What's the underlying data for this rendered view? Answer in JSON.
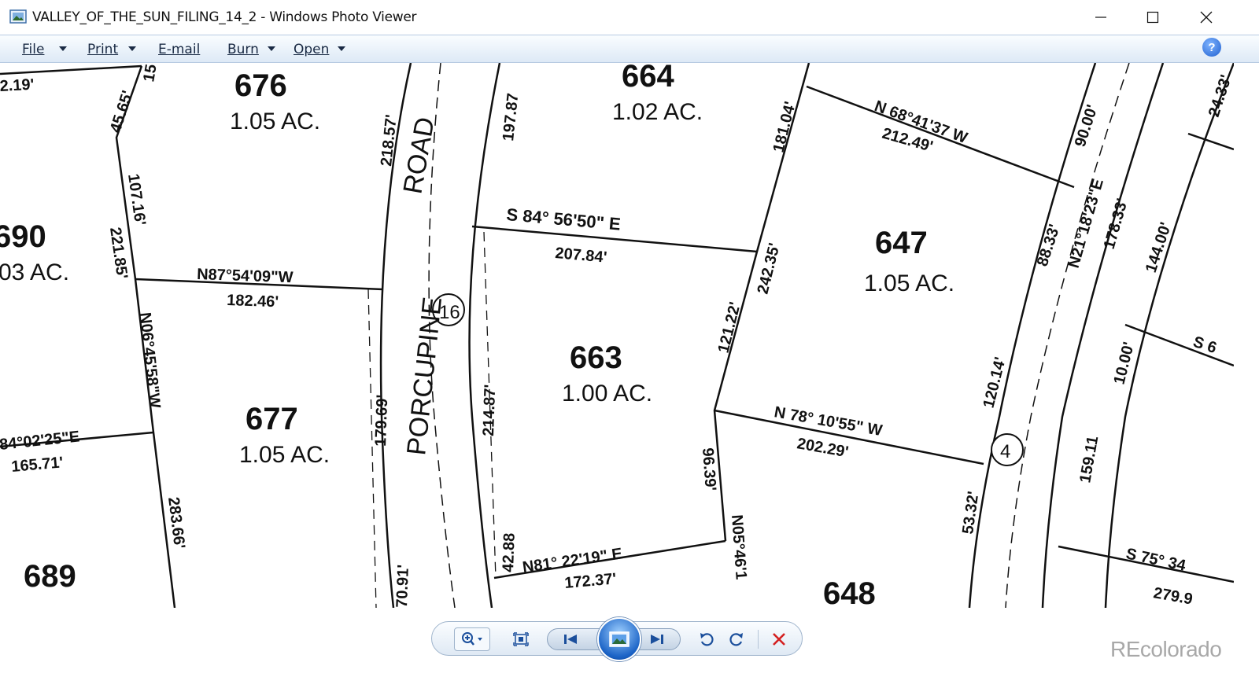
{
  "window": {
    "title": "VALLEY_OF_THE_SUN_FILING_14_2 - Windows Photo Viewer"
  },
  "menu": {
    "file": "File",
    "print": "Print",
    "email": "E-mail",
    "burn": "Burn",
    "open": "Open",
    "help": "?"
  },
  "map": {
    "lots": [
      {
        "number": "676",
        "acres": "1.05 AC."
      },
      {
        "number": "664",
        "acres": "1.02 AC."
      },
      {
        "number": "690",
        "acres": "03 AC."
      },
      {
        "number": "647",
        "acres": "1.05 AC."
      },
      {
        "number": "663",
        "acres": "1.00 AC."
      },
      {
        "number": "677",
        "acres": "1.05 AC."
      },
      {
        "number": "689"
      },
      {
        "number": "648"
      }
    ],
    "road": {
      "name": "PORCUPINE",
      "type": "ROAD",
      "number": "16",
      "number2": "4"
    },
    "bearings": {
      "b1": "S 84° 56'50\" E",
      "b2": "N87°54'09\"W",
      "b3": "N 68°41'37 W",
      "b4": "N 78° 10'55\" W",
      "b5": "N81° 22'19\" E",
      "b6": "N06°45'58\"W",
      "b7": "84°02'25\"E",
      "b8": "N21°18'23\"E",
      "b9": "N05°46'1",
      "b10": "S 75° 34",
      "b11": "S 6"
    },
    "distances": {
      "d1": "207.84'",
      "d2": "182.46'",
      "d3": "212.49'",
      "d4": "202.29'",
      "d5": "172.37'",
      "d6": "165.71'",
      "d7": "218.57'",
      "d8": "197.87",
      "d9": "181.04'",
      "d10": "242.35'",
      "d11": "121.22'",
      "d12": "214.87'",
      "d13": "179.69'",
      "d14": "96.39'",
      "d15": "42.88",
      "d16": "107.16'",
      "d17": "221.85'",
      "d18": "45.65'",
      "d19": "283.66'",
      "d20": "70.91'",
      "d21": "90.00'",
      "d22": "88.33'",
      "d23": "178.33'",
      "d24": "144.00'",
      "d25": "120.14'",
      "d26": "53.32'",
      "d27": "159.11",
      "d28": "10.00'",
      "d29": "24.33'",
      "d30": "279.9",
      "d31": "2.19'",
      "d32": "15"
    }
  },
  "watermark": "REcolorado",
  "colors": {
    "menubar": "#dde9f6",
    "accent": "#1b63c6",
    "delete": "#d42020"
  }
}
